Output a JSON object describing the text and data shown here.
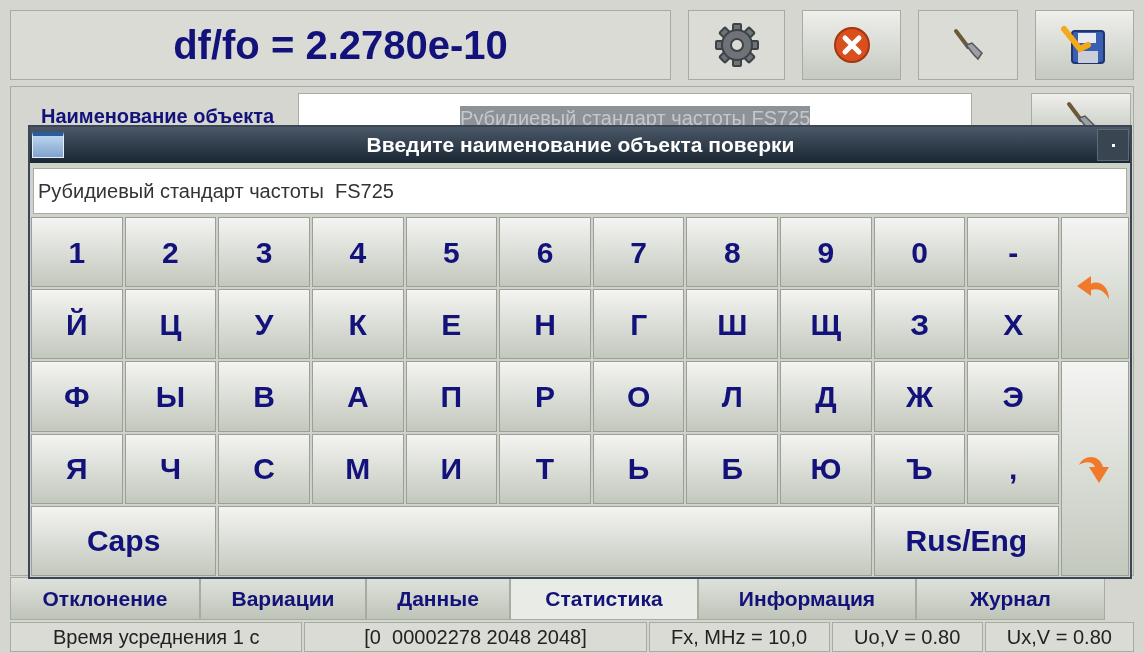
{
  "readout": "df/fo = 2.2780e-10",
  "object_row": {
    "label": "Наименование объекта",
    "value": "Рубидиевый стандарт частоты  FS725"
  },
  "dialog": {
    "title": "Введите наименование объекта поверки",
    "input_value": "Рубидиевый стандарт частоты  FS725",
    "key_rows": [
      [
        "1",
        "2",
        "3",
        "4",
        "5",
        "6",
        "7",
        "8",
        "9",
        "0",
        "-"
      ],
      [
        "Й",
        "Ц",
        "У",
        "К",
        "Е",
        "Н",
        "Г",
        "Ш",
        "Щ",
        "З",
        "Х"
      ],
      [
        "Ф",
        "Ы",
        "В",
        "А",
        "П",
        "Р",
        "О",
        "Л",
        "Д",
        "Ж",
        "Э"
      ],
      [
        "Я",
        "Ч",
        "С",
        "М",
        "И",
        "Т",
        "Ь",
        "Б",
        "Ю",
        "Ъ",
        ","
      ]
    ],
    "caps_key": "Caps",
    "lang_key": "Rus/Eng"
  },
  "tabs": [
    {
      "label": "Отклонение",
      "selected": false
    },
    {
      "label": "Вариации",
      "selected": false
    },
    {
      "label": "Данные",
      "selected": false
    },
    {
      "label": "Статистика",
      "selected": true
    },
    {
      "label": "Информация",
      "selected": false
    },
    {
      "label": "Журнал",
      "selected": false
    }
  ],
  "status_bar": [
    "Время усреднения 1 с",
    "[0  00002278 2048 2048]",
    "Fx, MHz = 10,0",
    "Uo,V = 0.80",
    "Ux,V = 0.80"
  ]
}
